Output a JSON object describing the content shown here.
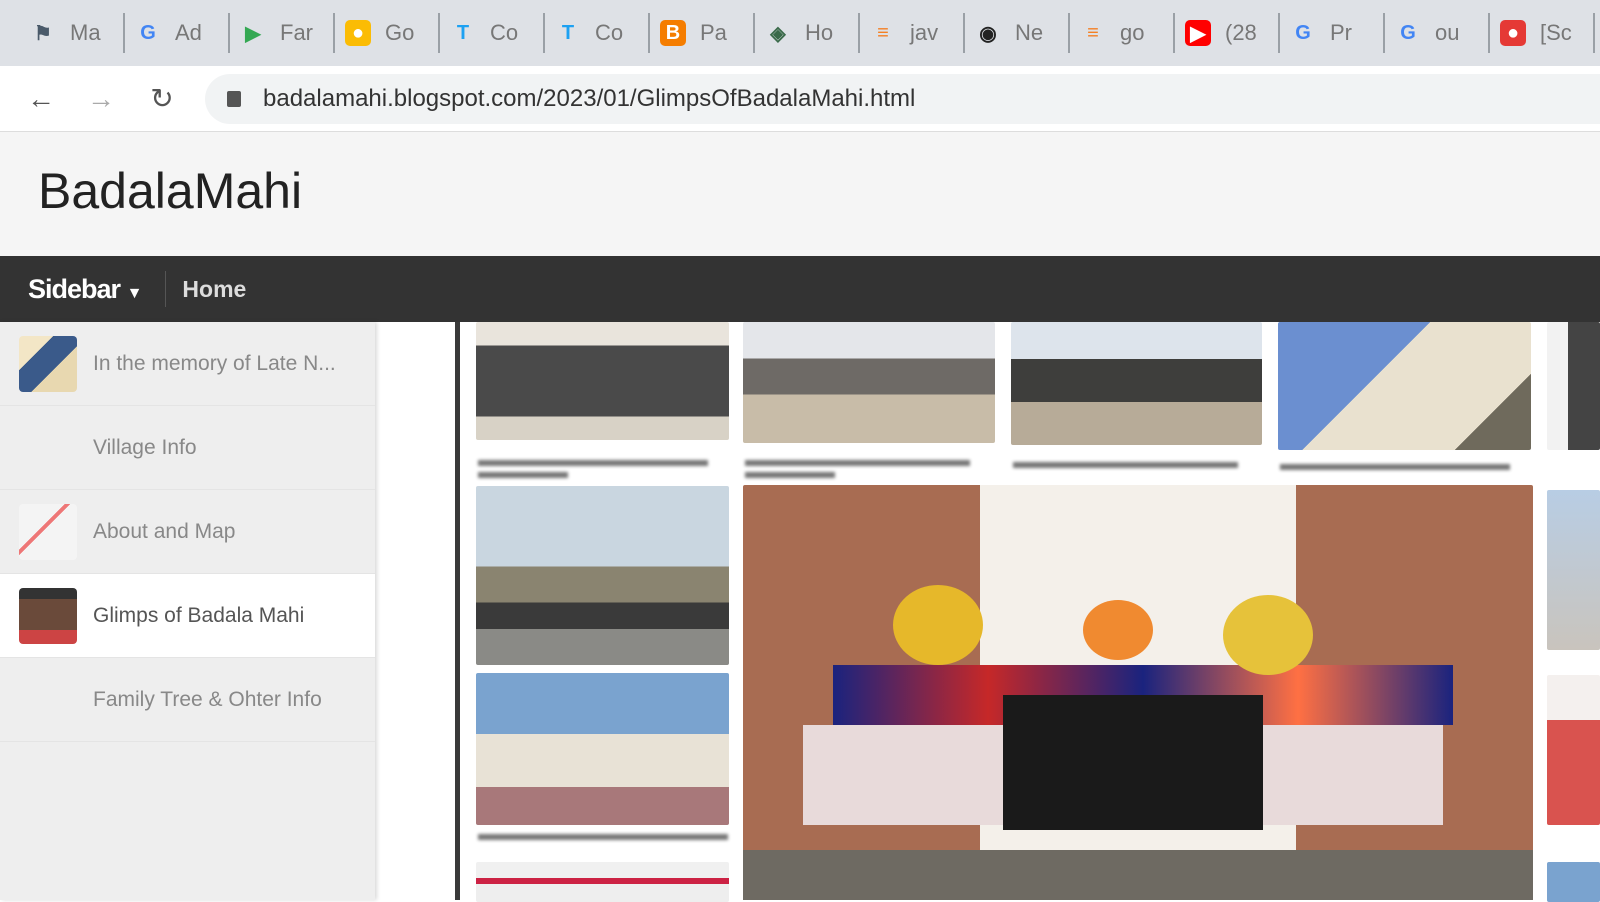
{
  "browser": {
    "tabs": [
      {
        "label": "Ma",
        "icon": "flag-icon",
        "color": "#4a5a6a"
      },
      {
        "label": "Ad",
        "icon": "google-icon",
        "color": "#4285f4"
      },
      {
        "label": "Far",
        "icon": "play-store-icon",
        "color": "#34a853"
      },
      {
        "label": "Go",
        "icon": "keep-icon",
        "color": "#fbbc04"
      },
      {
        "label": "Co",
        "icon": "t-icon",
        "color": "#1da1f2"
      },
      {
        "label": "Co",
        "icon": "t-icon",
        "color": "#1da1f2"
      },
      {
        "label": "Pa",
        "icon": "blogger-icon",
        "color": "#f57d00"
      },
      {
        "label": "Ho",
        "icon": "emblem-icon",
        "color": "#3a6a4a"
      },
      {
        "label": "jav",
        "icon": "stack-icon",
        "color": "#f48024"
      },
      {
        "label": "Ne",
        "icon": "github-icon",
        "color": "#222"
      },
      {
        "label": "go",
        "icon": "stack-icon",
        "color": "#f48024"
      },
      {
        "label": "(28",
        "icon": "youtube-icon",
        "color": "#ff0000"
      },
      {
        "label": "Pr",
        "icon": "google-icon",
        "color": "#4285f4"
      },
      {
        "label": "ou",
        "icon": "google-icon",
        "color": "#4285f4"
      },
      {
        "label": "[Sc",
        "icon": "ladybug-icon",
        "color": "#e53935"
      }
    ],
    "url": "badalamahi.blogspot.com/2023/01/GlimpsOfBadalaMahi.html"
  },
  "site": {
    "title": "BadalaMahi"
  },
  "navbar": {
    "sidebar_label": "Sidebar",
    "home_label": "Home"
  },
  "sidebar": {
    "items": [
      {
        "label": "In the memory of Late N...",
        "has_thumb": true,
        "selected": false
      },
      {
        "label": "Village Info",
        "has_thumb": false,
        "selected": false
      },
      {
        "label": "About and Map",
        "has_thumb": true,
        "selected": false
      },
      {
        "label": "Glimps of Badala Mahi",
        "has_thumb": true,
        "selected": true
      },
      {
        "label": "Family Tree & Ohter Info",
        "has_thumb": false,
        "selected": false
      }
    ]
  }
}
